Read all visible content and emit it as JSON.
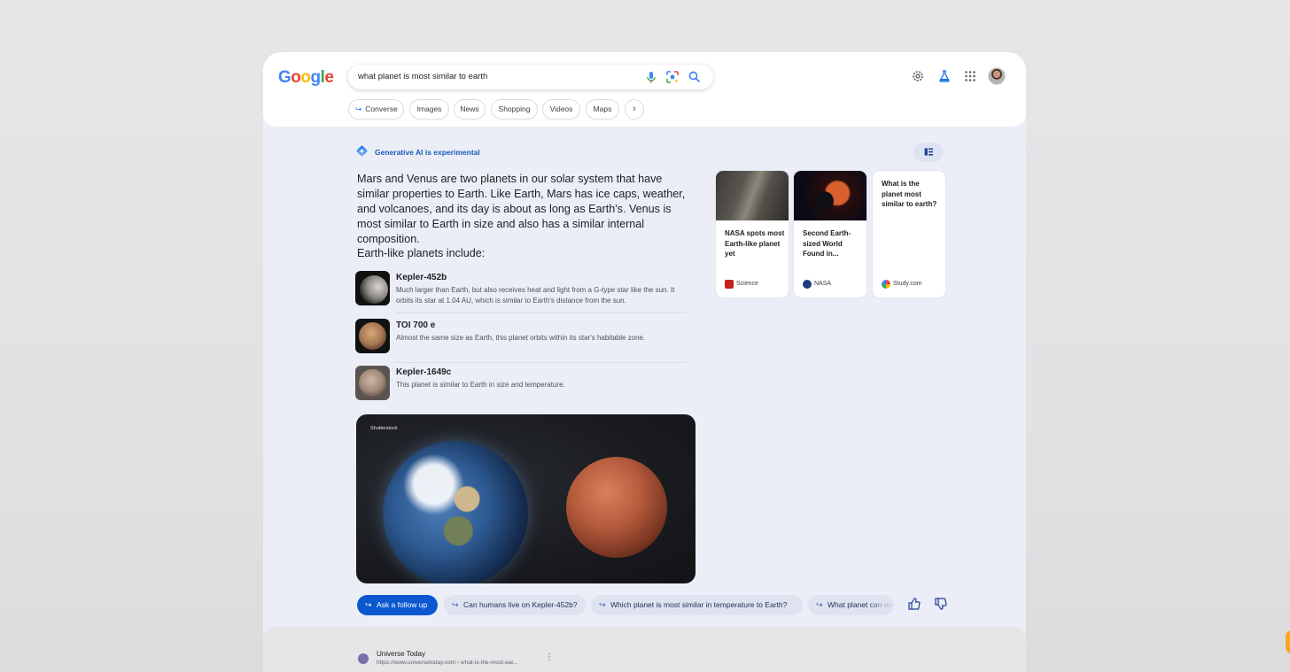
{
  "header": {
    "logo_text": "Google",
    "search_query": "what planet is most similar to earth",
    "icons": [
      "mic-icon",
      "lens-icon",
      "search-icon",
      "settings-icon",
      "labs-icon",
      "apps-icon",
      "avatar"
    ]
  },
  "chips": [
    {
      "label": "Converse",
      "icon": "follow-arrow-icon"
    },
    {
      "label": "Images"
    },
    {
      "label": "News"
    },
    {
      "label": "Shopping"
    },
    {
      "label": "Videos"
    },
    {
      "label": "Maps"
    }
  ],
  "sge": {
    "badge": "Generative AI is experimental",
    "answer": "Mars and Venus are two planets in our solar system that have similar properties to Earth. Like Earth, Mars has ice caps, weather, and volcanoes, and its day is about as long as Earth's. Venus is most similar to Earth in size and also has a similar internal composition.",
    "list_heading": "Earth-like planets include:",
    "planets": [
      {
        "name": "Kepler-452b",
        "desc": "Much larger than Earth, but also receives heat and light from a G-type star like the sun. It orbits its star at 1.04 AU, which is similar to Earth's distance from the sun."
      },
      {
        "name": "TOI 700 e",
        "desc": "Almost the same size as Earth, this planet orbits within its star's habitable zone."
      },
      {
        "name": "Kepler-1649c",
        "desc": "This planet is similar to Earth in size and temperature."
      }
    ],
    "image_credit": "Shutterstock",
    "cards": [
      {
        "title": "NASA spots most Earth-like planet yet",
        "source": "Science"
      },
      {
        "title": "Second Earth-sized World Found in...",
        "source": "NASA"
      },
      {
        "title": "What is the planet most similar to earth?",
        "source": "Study.com"
      }
    ],
    "followups": [
      "Ask a follow up",
      "Can humans live on Kepler-452b?",
      "Which planet is most similar in temperature to Earth?",
      "What planet can we"
    ]
  },
  "result": {
    "site": "Universe Today",
    "url": "https://www.universetoday.com › what-is-the-most-ear..."
  },
  "colors": {
    "accent": "#0b57d0",
    "page_bg": "#eceef7",
    "chip_bg": "#dfe3f0"
  }
}
